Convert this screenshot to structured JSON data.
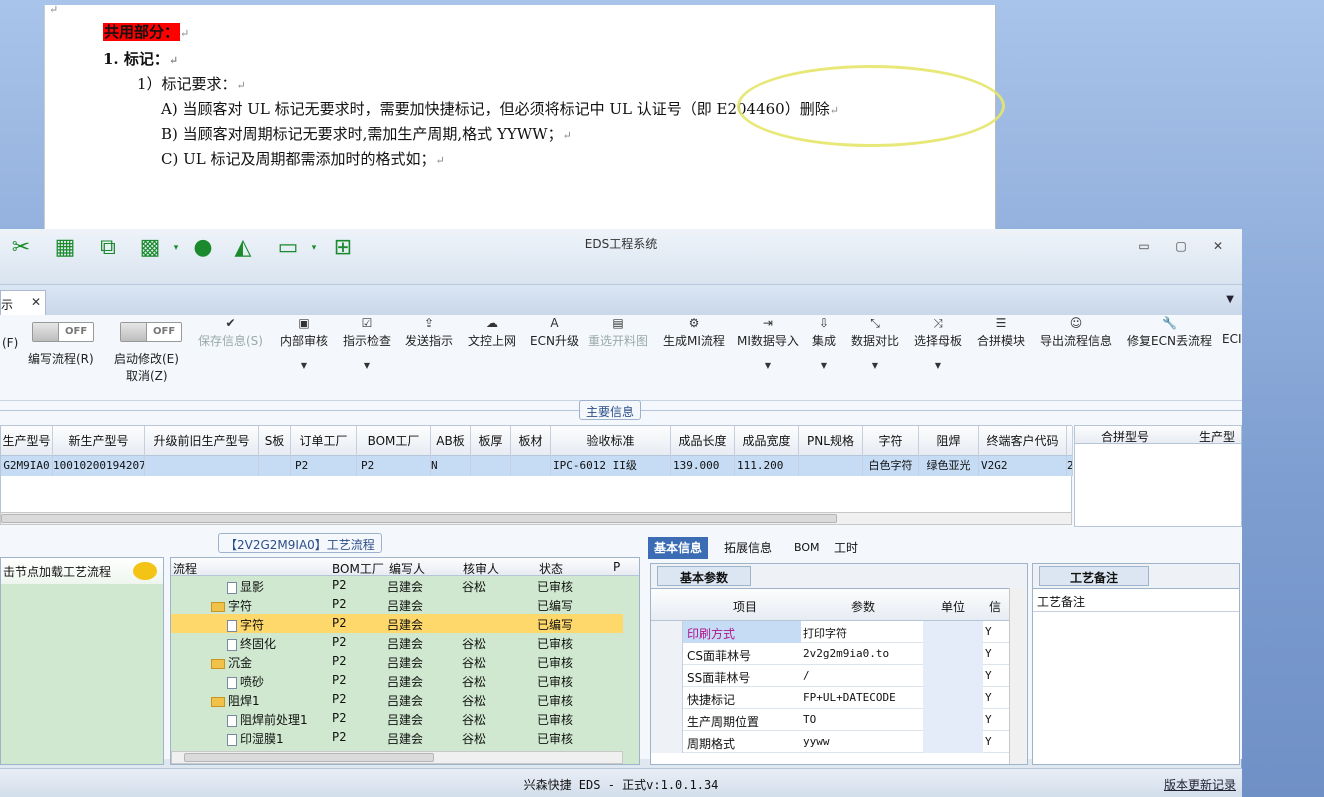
{
  "doc": {
    "heading": "共用部分：",
    "item1": "1.   标记：",
    "item1_sub": "1）标记要求：",
    "lineA": "A) 当顾客对 UL 标记无要求时，需要加快捷标记，但必须将标记中 UL 认证号（即 E204460）删除",
    "lineB": "B) 当顾客对周期标记无要求时,需加生产周期,格式 YYWW；",
    "lineC": "C) UL 标记及周期都需添加时的格式如；",
    "para": "↵"
  },
  "window": {
    "title": "EDS工程系统",
    "min": "▭",
    "max": "▢",
    "close": "✕"
  },
  "tab": {
    "label": "示",
    "close": "✕"
  },
  "ribbon": {
    "toggle_off": "OFF",
    "f_label": "(F)",
    "edit_flow": "编写流程(R)",
    "start_modify": "启动修改(E)",
    "cancel": "取消(Z)",
    "buttons": [
      "保存信息(S)",
      "内部审核",
      "指示检查",
      "发送指示",
      "文控上网",
      "ECN升级",
      "重选开料图",
      "生成MI流程",
      "MI数据导入",
      "集成",
      "数据对比",
      "选择母板",
      "合拼模块",
      "导出流程信息",
      "修复ECN丢流程",
      "ECI"
    ]
  },
  "main": {
    "section": "主要信息",
    "headers": [
      "生产型号",
      "新生产型号",
      "升级前旧生产型号",
      "S板",
      "订单工厂",
      "BOM工厂",
      "AB板",
      "板厚",
      "板材",
      "验收标准",
      "成品长度",
      "成品宽度",
      "PNL规格",
      "字符",
      "阻焊",
      "终端客户代码",
      ""
    ],
    "row": [
      "G2M9IA0",
      "10010200194207",
      "",
      "",
      "P2",
      "P2",
      "N",
      "",
      "",
      "IPC-6012 II级",
      "139.000",
      "111.200",
      "",
      "白色字符",
      "绿色亚光",
      "V2G2",
      "2"
    ],
    "right_headers": [
      "合拼型号",
      "生产型"
    ]
  },
  "lower": {
    "flow_title": "【2V2G2M9IA0】工艺流程",
    "left_hint": "击节点加载工艺流程",
    "tree_headers": [
      "流程",
      "BOM工厂",
      "编写人",
      "核审人",
      "状态",
      "P"
    ],
    "tree": [
      {
        "name": "显影",
        "type": "page",
        "factory": "P2",
        "writer": "吕建会",
        "checker": "谷松",
        "status": "已审核"
      },
      {
        "name": "字符",
        "type": "folder",
        "factory": "P2",
        "writer": "吕建会",
        "checker": "",
        "status": "已编写"
      },
      {
        "name": "字符",
        "type": "page",
        "factory": "P2",
        "writer": "吕建会",
        "checker": "",
        "status": "已编写",
        "selected": true
      },
      {
        "name": "终固化",
        "type": "page",
        "factory": "P2",
        "writer": "吕建会",
        "checker": "谷松",
        "status": "已审核"
      },
      {
        "name": "沉金",
        "type": "folder",
        "factory": "P2",
        "writer": "吕建会",
        "checker": "谷松",
        "status": "已审核"
      },
      {
        "name": "喷砂",
        "type": "page",
        "factory": "P2",
        "writer": "吕建会",
        "checker": "谷松",
        "status": "已审核"
      },
      {
        "name": "阻焊1",
        "type": "folder",
        "factory": "P2",
        "writer": "吕建会",
        "checker": "谷松",
        "status": "已审核"
      },
      {
        "name": "阻焊前处理1",
        "type": "page",
        "factory": "P2",
        "writer": "吕建会",
        "checker": "谷松",
        "status": "已审核"
      },
      {
        "name": "印湿膜1",
        "type": "page",
        "factory": "P2",
        "writer": "吕建会",
        "checker": "谷松",
        "status": "已审核"
      }
    ],
    "info_tabs": [
      "基本信息",
      "拓展信息",
      "BOM",
      "工时"
    ],
    "param_tab": "基本参数",
    "param_headers": [
      "项目",
      "参数",
      "单位",
      "信"
    ],
    "params": [
      {
        "item": "印刷方式",
        "value": "打印字符",
        "unit": "",
        "flag": "Y",
        "highlight": true
      },
      {
        "item": "CS面菲林号",
        "value": "2v2g2m9ia0.to",
        "unit": "",
        "flag": "Y"
      },
      {
        "item": "SS面菲林号",
        "value": "/",
        "unit": "",
        "flag": "Y"
      },
      {
        "item": "快捷标记",
        "value": "FP+UL+DATECODE",
        "unit": "",
        "flag": "Y"
      },
      {
        "item": "生产周期位置",
        "value": "TO",
        "unit": "",
        "flag": "Y"
      },
      {
        "item": "周期格式",
        "value": "yyww",
        "unit": "",
        "flag": "Y"
      }
    ],
    "note_tab": "工艺备注",
    "note_header": "工艺备注"
  },
  "status": {
    "center": "兴森快捷 EDS - 正式v:1.0.1.34",
    "link": "版本更新记录"
  },
  "colors": {
    "accent": "#1a8a2c",
    "selection": "#c6dcf5",
    "tree_bg": "#cfe8cf",
    "tab_active": "#3b6cb4"
  }
}
